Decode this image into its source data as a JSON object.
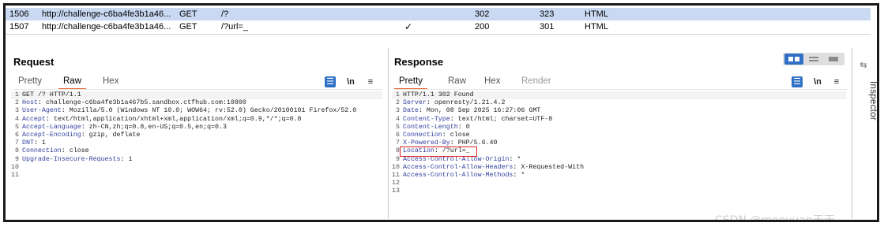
{
  "history": {
    "rows": [
      {
        "num": "1506",
        "host": "http://challenge-c6ba4fe3b1a46...",
        "method": "GET",
        "url": "/?",
        "check": "",
        "status": "302",
        "length": "323",
        "mime": "HTML",
        "selected": true
      },
      {
        "num": "1507",
        "host": "http://challenge-c6ba4fe3b1a46...",
        "method": "GET",
        "url": "/?url=_",
        "check": "✓",
        "status": "200",
        "length": "301",
        "mime": "HTML",
        "selected": false
      }
    ]
  },
  "request": {
    "title": "Request",
    "tabs": [
      "Pretty",
      "Raw",
      "Hex"
    ],
    "active_tab": "Raw",
    "lines": [
      {
        "n": "1",
        "h": "",
        "v": "GET /? HTTP/1.1"
      },
      {
        "n": "2",
        "h": "Host",
        "v": "challenge-c6ba4fe3b1a467b5.sandbox.ctfhub.com:10800"
      },
      {
        "n": "3",
        "h": "User-Agent",
        "v": "Mozilla/5.0 (Windows NT 10.0; WOW64; rv:52.0) Gecko/20100101 Firefox/52.0"
      },
      {
        "n": "4",
        "h": "Accept",
        "v": "text/html,application/xhtml+xml,application/xml;q=0.9,*/*;q=0.8"
      },
      {
        "n": "5",
        "h": "Accept-Language",
        "v": "zh-CN,zh;q=0.8,en-US;q=0.5,en;q=0.3"
      },
      {
        "n": "6",
        "h": "Accept-Encoding",
        "v": "gzip, deflate"
      },
      {
        "n": "7",
        "h": "DNT",
        "v": "1"
      },
      {
        "n": "8",
        "h": "Connection",
        "v": "close"
      },
      {
        "n": "9",
        "h": "Upgrade-Insecure-Requests",
        "v": "1"
      },
      {
        "n": "10",
        "h": "",
        "v": ""
      },
      {
        "n": "11",
        "h": "",
        "v": ""
      }
    ]
  },
  "response": {
    "title": "Response",
    "tabs": [
      "Pretty",
      "Raw",
      "Hex",
      "Render"
    ],
    "active_tab": "Pretty",
    "lines": [
      {
        "n": "1",
        "h": "",
        "v": "HTTP/1.1 302 Found"
      },
      {
        "n": "2",
        "h": "Server",
        "v": "openresty/1.21.4.2"
      },
      {
        "n": "3",
        "h": "Date",
        "v": "Mon, 08 Sep 2025 16:27:06 GMT"
      },
      {
        "n": "4",
        "h": "Content-Type",
        "v": "text/html; charset=UTF-8"
      },
      {
        "n": "5",
        "h": "Content-Length",
        "v": "0"
      },
      {
        "n": "6",
        "h": "Connection",
        "v": "close"
      },
      {
        "n": "7",
        "h": "X-Powered-By",
        "v": "PHP/5.6.40"
      },
      {
        "n": "8",
        "h": "Location",
        "v": "/?url=_"
      },
      {
        "n": "9",
        "h": "Access-Control-Allow-Origin",
        "v": "*"
      },
      {
        "n": "10",
        "h": "Access-Control-Allow-Headers",
        "v": "X-Requested-With"
      },
      {
        "n": "11",
        "h": "Access-Control-Allow-Methods",
        "v": "*"
      },
      {
        "n": "12",
        "h": "",
        "v": ""
      },
      {
        "n": "13",
        "h": "",
        "v": ""
      }
    ]
  },
  "toolbar": {
    "wrap_icon": "wrap-lines-icon",
    "newline_label": "\\n",
    "menu_icon": "hamburger-menu-icon"
  },
  "inspector": {
    "label": "Inspector"
  },
  "watermark": "CSDN @mooyuan天天",
  "colors": {
    "accent": "#e8652a",
    "selected_row": "#c9d9f2",
    "header_name": "#2e3f9e",
    "highlight": "#e02020",
    "tool_blue": "#2f6fc4"
  }
}
